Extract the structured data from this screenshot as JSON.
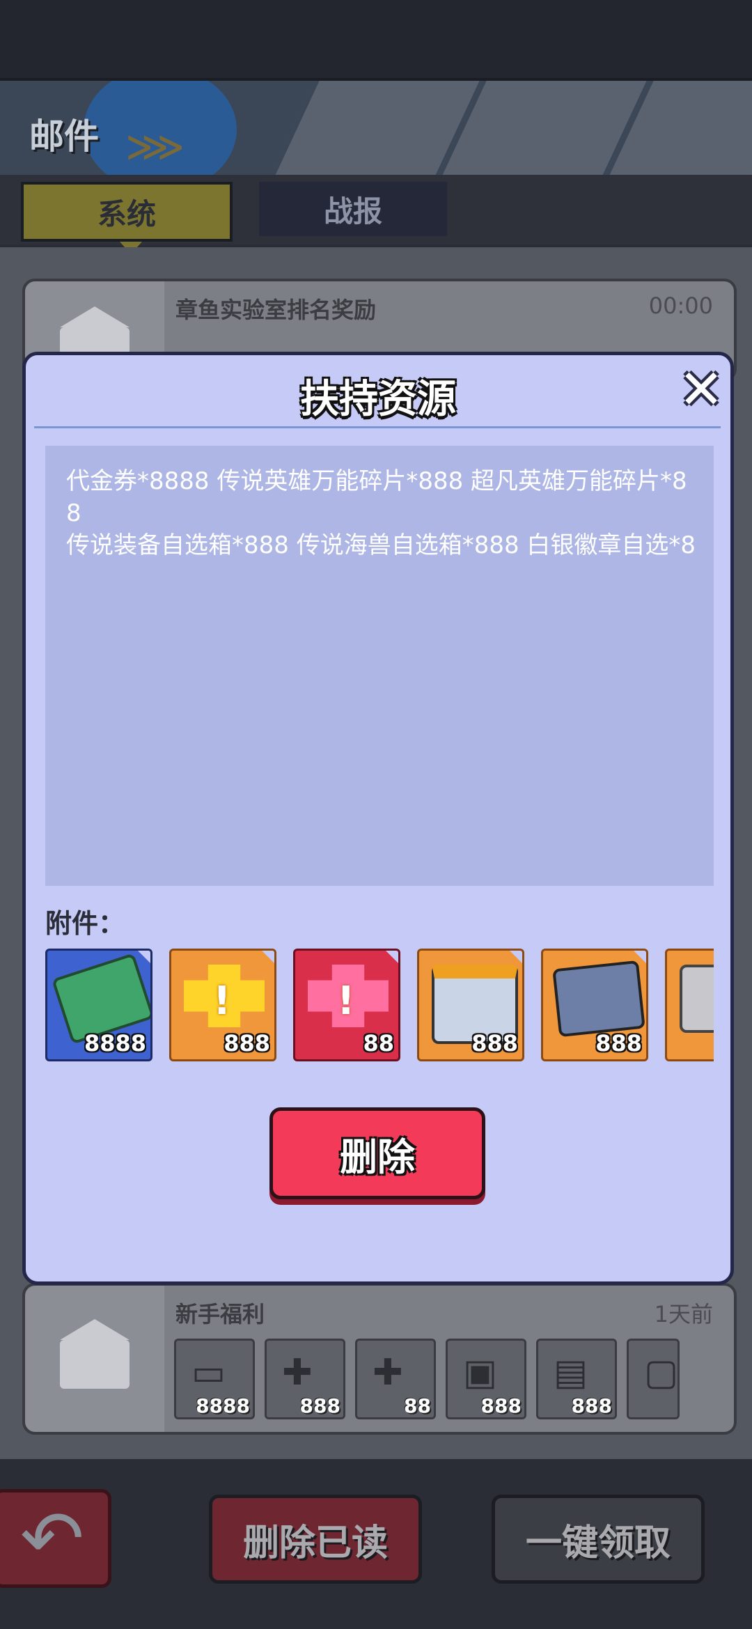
{
  "header": {
    "title": "邮件"
  },
  "tabs": [
    {
      "label": "系统"
    },
    {
      "label": "战报"
    }
  ],
  "mails": [
    {
      "title": "章鱼实验室排名奖励",
      "time": "00:00"
    },
    {
      "title": "新手福利",
      "time": "1天前",
      "items": [
        {
          "count": "8888"
        },
        {
          "count": "888"
        },
        {
          "count": "88"
        },
        {
          "count": "888"
        },
        {
          "count": "888"
        },
        {
          "count": ""
        }
      ]
    }
  ],
  "dialog": {
    "title": "扶持资源",
    "content": "代金券*8888 传说英雄万能碎片*888 超凡英雄万能碎片*88\n传说装备自选箱*888 传说海兽自选箱*888  白银徽章自选*8",
    "attachments_label": "附件：",
    "attachments": [
      {
        "icon": "cash-voucher-icon",
        "count": "8888"
      },
      {
        "icon": "gold-puzzle-shard-icon",
        "count": "888"
      },
      {
        "icon": "pink-puzzle-shard-icon",
        "count": "88"
      },
      {
        "icon": "equipment-chest-icon",
        "count": "888"
      },
      {
        "icon": "sea-beast-cards-icon",
        "count": "888"
      },
      {
        "icon": "silver-badge-icon",
        "count": ""
      }
    ],
    "delete_label": "删除",
    "close_icon": "close-icon"
  },
  "bottom": {
    "back_icon": "back-arrow-icon",
    "delete_read_label": "删除已读",
    "claim_all_label": "一键领取"
  },
  "colors": {
    "modal_bg": "#c6caf7",
    "delete_button": "#f33a58",
    "content_box": "#adb6e4"
  }
}
